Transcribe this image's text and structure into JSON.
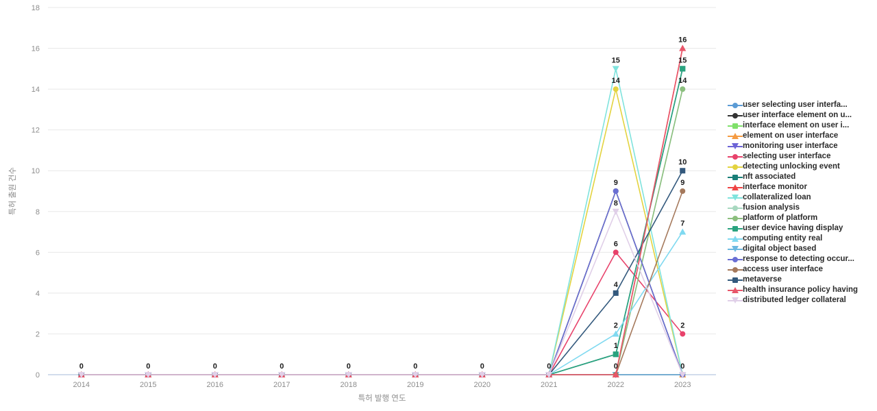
{
  "chart_data": {
    "type": "line",
    "title": "",
    "xlabel": "특허 발행 연도",
    "ylabel": "특허 출원 건수",
    "categories": [
      "2014",
      "2015",
      "2016",
      "2017",
      "2018",
      "2019",
      "2020",
      "2021",
      "2022",
      "2023"
    ],
    "x": [
      2014,
      2015,
      2016,
      2017,
      2018,
      2019,
      2020,
      2021,
      2022,
      2023
    ],
    "ylim": [
      0,
      18
    ],
    "yticks": [
      0,
      2,
      4,
      6,
      8,
      10,
      12,
      14,
      16,
      18
    ],
    "grid": true,
    "legend_position": "right",
    "point_labels_shown": true,
    "series": [
      {
        "name": "user selecting user interfa...",
        "color": "#5b9bd5",
        "marker": "circle",
        "values": [
          0,
          0,
          0,
          0,
          0,
          0,
          0,
          0,
          0,
          0
        ]
      },
      {
        "name": "user interface element on u...",
        "color": "#333333",
        "marker": "circle",
        "values": [
          0,
          0,
          0,
          0,
          0,
          0,
          0,
          0,
          9,
          0
        ]
      },
      {
        "name": "interface element on user i...",
        "color": "#7fe06a",
        "marker": "square",
        "values": [
          0,
          0,
          0,
          0,
          0,
          0,
          0,
          0,
          0,
          0
        ]
      },
      {
        "name": "element on user interface",
        "color": "#f59b42",
        "marker": "tri-up",
        "values": [
          0,
          0,
          0,
          0,
          0,
          0,
          0,
          0,
          0,
          0
        ]
      },
      {
        "name": "monitoring user interface",
        "color": "#6c63d6",
        "marker": "tri-down",
        "values": [
          0,
          0,
          0,
          0,
          0,
          0,
          0,
          0,
          0,
          0
        ]
      },
      {
        "name": "selecting user interface",
        "color": "#e8426b",
        "marker": "circle",
        "values": [
          0,
          0,
          0,
          0,
          0,
          0,
          0,
          0,
          6,
          2
        ]
      },
      {
        "name": "detecting unlocking event",
        "color": "#e3d33f",
        "marker": "circle",
        "values": [
          0,
          0,
          0,
          0,
          0,
          0,
          0,
          0,
          14,
          0
        ]
      },
      {
        "name": "nft associated",
        "color": "#1a7f78",
        "marker": "square",
        "values": [
          0,
          0,
          0,
          0,
          0,
          0,
          0,
          0,
          1,
          15
        ]
      },
      {
        "name": "interface monitor",
        "color": "#ef4444",
        "marker": "tri-up",
        "values": [
          0,
          0,
          0,
          0,
          0,
          0,
          0,
          0,
          0,
          16
        ]
      },
      {
        "name": "collateralized loan",
        "color": "#7fe3dd",
        "marker": "tri-down",
        "values": [
          0,
          0,
          0,
          0,
          0,
          0,
          0,
          0,
          15,
          0
        ]
      },
      {
        "name": "fusion analysis",
        "color": "#a8d8c0",
        "marker": "circle",
        "values": [
          0,
          0,
          0,
          0,
          0,
          0,
          0,
          0,
          0,
          14
        ]
      },
      {
        "name": "platform of platform",
        "color": "#8cbf7e",
        "marker": "circle",
        "values": [
          0,
          0,
          0,
          0,
          0,
          0,
          0,
          0,
          0,
          14
        ]
      },
      {
        "name": "user device having display",
        "color": "#2aa37f",
        "marker": "square",
        "values": [
          0,
          0,
          0,
          0,
          0,
          0,
          0,
          0,
          1,
          15
        ]
      },
      {
        "name": "computing entity real",
        "color": "#7fd9f0",
        "marker": "tri-up",
        "values": [
          0,
          0,
          0,
          0,
          0,
          0,
          0,
          0,
          2,
          7
        ]
      },
      {
        "name": "digital object based",
        "color": "#6cb8e0",
        "marker": "tri-down",
        "values": [
          0,
          0,
          0,
          0,
          0,
          0,
          0,
          0,
          0,
          0
        ]
      },
      {
        "name": "response to detecting occur...",
        "color": "#6a6fd4",
        "marker": "circle",
        "values": [
          0,
          0,
          0,
          0,
          0,
          0,
          0,
          0,
          9,
          0
        ]
      },
      {
        "name": "access user interface",
        "color": "#a5795c",
        "marker": "circle",
        "values": [
          0,
          0,
          0,
          0,
          0,
          0,
          0,
          0,
          0,
          9
        ]
      },
      {
        "name": "metaverse",
        "color": "#33597d",
        "marker": "square",
        "values": [
          0,
          0,
          0,
          0,
          0,
          0,
          0,
          0,
          4,
          10
        ]
      },
      {
        "name": "health insurance policy having",
        "color": "#e8566a",
        "marker": "tri-up",
        "values": [
          0,
          0,
          0,
          0,
          0,
          0,
          0,
          0,
          0,
          16
        ]
      },
      {
        "name": "distributed ledger collateral",
        "color": "#e0cfe8",
        "marker": "tri-down",
        "values": [
          0,
          0,
          0,
          0,
          0,
          0,
          0,
          0,
          8,
          0
        ]
      }
    ],
    "point_labels": [
      {
        "x": 2014,
        "y": 0,
        "text": "0"
      },
      {
        "x": 2015,
        "y": 0,
        "text": "0"
      },
      {
        "x": 2016,
        "y": 0,
        "text": "0"
      },
      {
        "x": 2017,
        "y": 0,
        "text": "0"
      },
      {
        "x": 2018,
        "y": 0,
        "text": "0"
      },
      {
        "x": 2019,
        "y": 0,
        "text": "0"
      },
      {
        "x": 2020,
        "y": 0,
        "text": "0"
      },
      {
        "x": 2021,
        "y": 0,
        "text": "0"
      },
      {
        "x": 2022,
        "y": 0,
        "text": "0"
      },
      {
        "x": 2022,
        "y": 1,
        "text": "1"
      },
      {
        "x": 2022,
        "y": 2,
        "text": "2"
      },
      {
        "x": 2022,
        "y": 4,
        "text": "4"
      },
      {
        "x": 2022,
        "y": 6,
        "text": "6"
      },
      {
        "x": 2022,
        "y": 8,
        "text": "8"
      },
      {
        "x": 2022,
        "y": 9,
        "text": "9"
      },
      {
        "x": 2022,
        "y": 14,
        "text": "14"
      },
      {
        "x": 2022,
        "y": 15,
        "text": "15"
      },
      {
        "x": 2023,
        "y": 0,
        "text": "0"
      },
      {
        "x": 2023,
        "y": 2,
        "text": "2"
      },
      {
        "x": 2023,
        "y": 7,
        "text": "7"
      },
      {
        "x": 2023,
        "y": 9,
        "text": "9"
      },
      {
        "x": 2023,
        "y": 10,
        "text": "10"
      },
      {
        "x": 2023,
        "y": 14,
        "text": "14"
      },
      {
        "x": 2023,
        "y": 15,
        "text": "15"
      },
      {
        "x": 2023,
        "y": 16,
        "text": "16"
      }
    ]
  },
  "colors": {
    "gridline": "#e8e8e8",
    "zero_axis": "#b7c7e0",
    "tick_text": "#8c8c8c",
    "label_text": "#1a1a1a",
    "legend_text": "#2b2b2b",
    "background": "#ffffff"
  }
}
